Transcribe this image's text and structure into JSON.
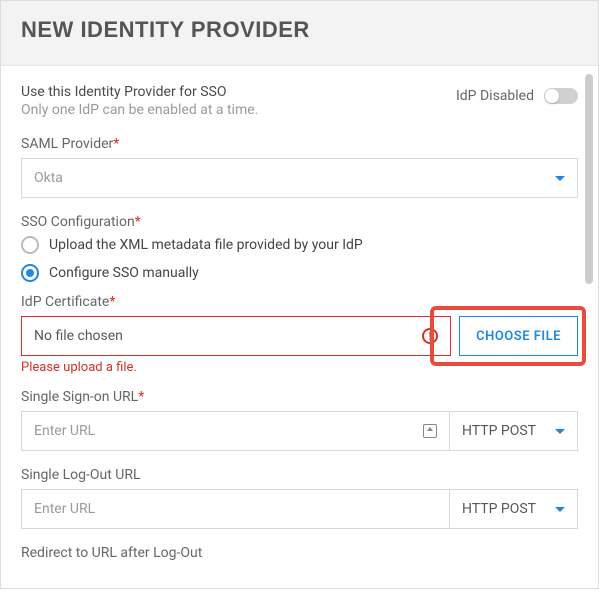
{
  "header": {
    "title": "NEW IDENTITY PROVIDER"
  },
  "sso": {
    "use_label": "Use this Identity Provider for SSO",
    "use_hint": "Only one IdP can be enabled at a time.",
    "toggle_label": "IdP Disabled"
  },
  "provider": {
    "label": "SAML Provider",
    "value": "Okta"
  },
  "config": {
    "label": "SSO Configuration",
    "option_upload": "Upload the XML metadata file provided by your IdP",
    "option_manual": "Configure SSO manually"
  },
  "cert": {
    "label": "IdP Certificate",
    "placeholder": "No file chosen",
    "button": "CHOOSE FILE",
    "error": "Please upload a file."
  },
  "sso_url": {
    "label": "Single Sign-on URL",
    "placeholder": "Enter URL",
    "method": "HTTP POST"
  },
  "slo_url": {
    "label": "Single Log-Out URL",
    "placeholder": "Enter URL",
    "method": "HTTP POST"
  },
  "redirect": {
    "label": "Redirect to URL after Log-Out"
  }
}
